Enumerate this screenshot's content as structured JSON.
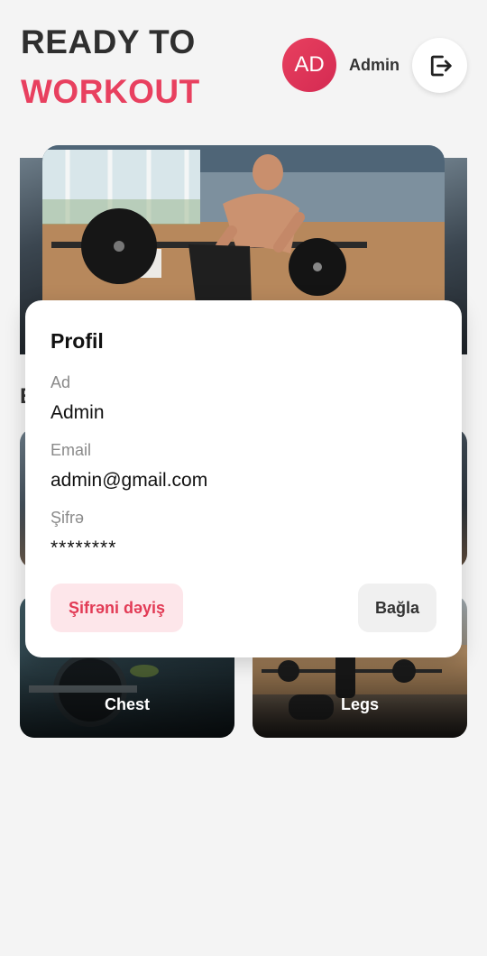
{
  "header": {
    "title_line1": "READY TO",
    "title_line2": "WORKOUT",
    "avatar_initials": "AD",
    "user_name": "Admin",
    "logout_icon": "logout-icon"
  },
  "background": {
    "section_letter": "E",
    "cards": [
      {
        "label": "Chest"
      },
      {
        "label": "Legs"
      }
    ]
  },
  "profile_modal": {
    "title": "Profil",
    "fields": [
      {
        "label": "Ad",
        "value": "Admin"
      },
      {
        "label": "Email",
        "value": "admin@gmail.com"
      },
      {
        "label": "Şifrə",
        "value": "********"
      }
    ],
    "change_password_label": "Şifrəni dəyiş",
    "close_label": "Bağla"
  },
  "colors": {
    "accent": "#e8405f",
    "background": "#f4f4f4"
  }
}
